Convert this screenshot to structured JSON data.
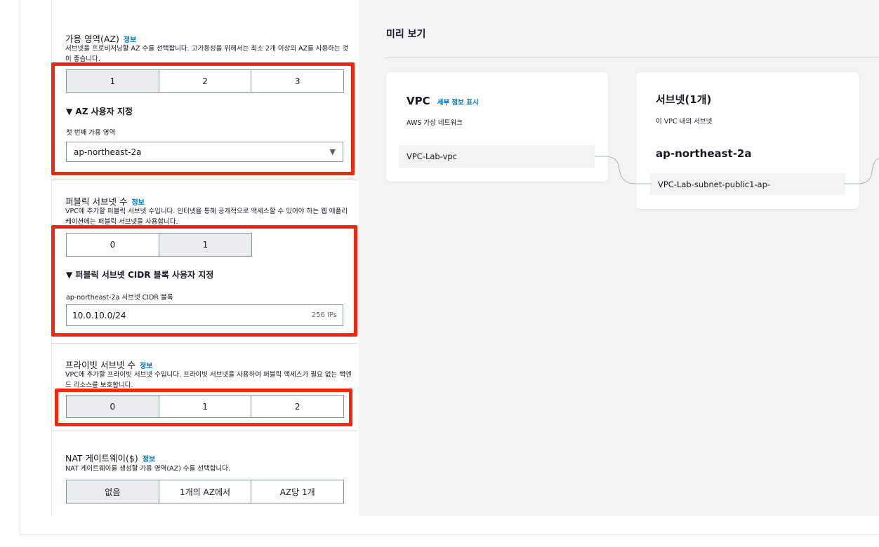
{
  "left": {
    "az": {
      "title": "가용 영역(AZ)",
      "info": "정보",
      "description": "서브넷을 프로비저닝할 AZ 수를 선택합니다. 고가용성을 위해서는 최소 2개 이상의 AZ를 사용하는 것이 좋습니다.",
      "options": [
        "1",
        "2",
        "3"
      ],
      "selected": "1",
      "customize_label": "▼ AZ 사용자 지정",
      "first_az_label": "첫 번째 가용 영역",
      "first_az_value": "ap-northeast-2a"
    },
    "public_subnets": {
      "title": "퍼블릭 서브넷 수",
      "info": "정보",
      "description": "VPC에 추가할 퍼블릭 서브넷 수입니다. 인터넷을 통해 공개적으로 액세스할 수 있어야 하는 웹 애플리케이션에는 퍼블릭 서브넷을 사용합니다.",
      "options": [
        "0",
        "1"
      ],
      "selected": "1",
      "customize_label": "▼ 퍼블릭 서브넷 CIDR 블록 사용자 지정",
      "cidr_label": "ap-northeast-2a 서브넷 CIDR 블록",
      "cidr_value": "10.0.10.0/24",
      "cidr_ips": "256 IPs"
    },
    "private_subnets": {
      "title": "프라이빗 서브넷 수",
      "info": "정보",
      "description": "VPC에 추가할 프라이빗 서브넷 수입니다. 프라이빗 서브넷을 사용하여 퍼블릭 액세스가 필요 없는 백엔드 리소스를 보호합니다.",
      "options": [
        "0",
        "1",
        "2"
      ],
      "selected": "0"
    },
    "nat": {
      "title": "NAT 게이트웨이($)",
      "info": "정보",
      "description": "NAT 게이트웨이를 생성할 가용 영역(AZ) 수를 선택합니다.",
      "options": [
        "없음",
        "1개의 AZ에서",
        "AZ당 1개"
      ],
      "selected": "없음"
    }
  },
  "preview": {
    "title": "미리 보기",
    "vpc_card": {
      "title": "VPC",
      "detail_link": "세부 정보 표시",
      "subtitle": "AWS 가상 네트워크",
      "item": "VPC-Lab-vpc"
    },
    "subnet_card": {
      "title": "서브넷(1개)",
      "subtitle": "이 VPC 내의 서브넷",
      "az": "ap-northeast-2a",
      "item": "VPC-Lab-subnet-public1-ap-"
    }
  },
  "colors": {
    "highlight": "#f4270f",
    "link": "#0073bb",
    "selected_option": "#eaeded",
    "preview_bg": "#f2f3f3"
  }
}
